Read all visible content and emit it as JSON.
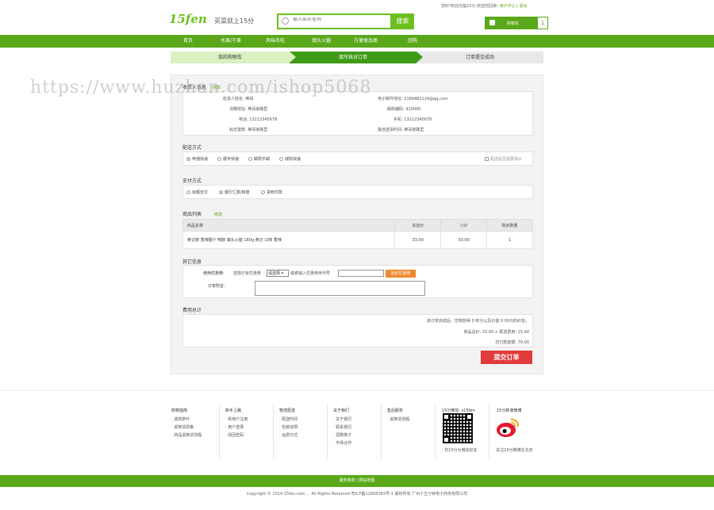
{
  "header": {
    "logo_text": "15fen",
    "slogan": "买菜就上15分",
    "search_placeholder": "输入菜名查询",
    "search_button": "搜索",
    "welcome": "您好!欢迎光临15分,欢迎您回来!",
    "user_center": "用户中心",
    "logout": "退出",
    "cart_label": "购物车",
    "cart_count": "1"
  },
  "nav": [
    "首页",
    "水果/干果",
    "风味名吃",
    "镇头火腿",
    "方便食品类",
    "团购"
  ],
  "steps": [
    "我的购物车",
    "填写核对订单",
    "订单提交成功"
  ],
  "watermark": "https://www.huzhan.com/ishop5068",
  "consignee": {
    "title": "收货人信息",
    "edit": "修改",
    "name_label": "收货人姓名:",
    "name": "棒哥",
    "email_label": "电子邮件地址:",
    "email": "2189482124@qq.com",
    "address_label": "详细地址:",
    "address": "棒哥家路里",
    "zip_label": "邮政编码:",
    "zip": "410000",
    "phone_label": "电话:",
    "phone": "13212345678",
    "mobile_label": "手机:",
    "mobile": "13212345678",
    "sign_label": "标志建筑:",
    "sign": "棒哥家路里",
    "time_label": "最佳送货时间:",
    "time": "棒哥家路里"
  },
  "shipping": {
    "title": "配送方式",
    "options": [
      "申通快递",
      "顺丰快递",
      "邮局平邮",
      "城际快递"
    ],
    "insure": "配送是否需要保价"
  },
  "payment": {
    "title": "支付方式",
    "options": [
      "余额支付",
      "银行汇款/转账",
      "货到付款"
    ]
  },
  "goods": {
    "title": "商品列表",
    "back": "修改",
    "headers": [
      "商品名称",
      "本店价",
      "小计",
      "购买数量"
    ],
    "rows": [
      {
        "name": "黄记牌 香辣腊汁 鸭脖 镇头火腿 180g 黄记 口味 香辣",
        "price": "33.00",
        "subtotal": "33.00",
        "qty": "1"
      }
    ]
  },
  "other": {
    "title": "其它信息",
    "coupon_label": "使用优惠券:",
    "coupon_hint1": "选择已有优惠券",
    "coupon_select": "请选择",
    "coupon_hint2": "或者输入优惠券序列号",
    "coupon_button": "验证优惠券",
    "remark_label": "订单附言:"
  },
  "total": {
    "title": "费用总计",
    "line1": "该订单完成后，您将获得 0 积分以及价值 0.00元的红包。",
    "line2": "商品总价: 33.00 + 配送费用: 15.00",
    "line3": "应付款金额: 70.00",
    "submit": "提交订单"
  },
  "footer": {
    "cols": [
      {
        "title": "购物指南",
        "items": [
          "选购茶叶",
          "退换货政策",
          "商品退换货流程"
        ]
      },
      {
        "title": "新手上路",
        "items": [
          "新用户注册",
          "用户登录",
          "找回密码"
        ]
      },
      {
        "title": "物流配送",
        "items": [
          "配送时间",
          "包装说明",
          "运费方式"
        ]
      },
      {
        "title": "关于我们",
        "items": [
          "关于我们",
          "联系我们",
          "招聘英才",
          "市场合作"
        ]
      },
      {
        "title": "售后服务",
        "items": [
          "退换货流程"
        ]
      }
    ],
    "wechat_title": "15分微信: z15fen",
    "wechat_note": "扫15分为微信好友",
    "weibo_title": "15分新浪微博",
    "weibo_note": "关注15分微博在北京",
    "bar_links": "服务条款 | 网站地图",
    "copyright": "Copyright © 2014 15fen.com ， All Rights Reserved 粤ICP备12008383号-1 版权所有 广州十五分钟电子商务有限公司"
  },
  "colors": {
    "brand": "#5aa81a",
    "step_active": "#3f9b16",
    "submit": "#e23b3b",
    "coupon_btn": "#f08a2e"
  }
}
